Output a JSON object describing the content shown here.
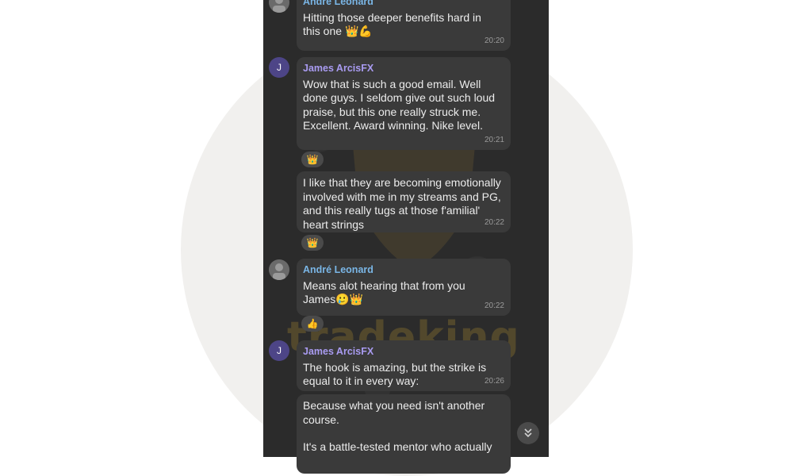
{
  "messages": [
    {
      "sender": "André Leonard",
      "text_line1": "Hitting those deeper benefits hard in",
      "text_line2": "this one",
      "emoji": "👑💪",
      "time": "20:20"
    },
    {
      "sender": "James ArcisFX",
      "avatar_letter": "J",
      "text": "Wow that is such a good email. Well done guys. I seldom give out such loud praise, but this one really struck me. Excellent. Award winning. Nike level.",
      "time": "20:21",
      "reaction": "👑"
    },
    {
      "text": "I like that they are becoming emotionally involved with me in my streams and PG, and this really tugs at those f'amilial' heart strings",
      "time": "20:22",
      "reaction": "👑"
    },
    {
      "sender": "André Leonard",
      "text_line1": "Means alot hearing that from you",
      "text_line2": "James",
      "emoji": "🥲👑",
      "time": "20:22",
      "reaction": "👍"
    },
    {
      "sender": "James ArcisFX",
      "avatar_letter": "J",
      "text": "The hook is amazing, but the strike is equal to it in every way:",
      "time": "20:26"
    },
    {
      "text_p1": "Because what you need isn't another course.",
      "text_p2": "It's a battle-tested mentor who actually"
    }
  ],
  "watermark": "tradeking",
  "colors": {
    "bubble": "#3a3a3a",
    "name_purple": "#a99bf1",
    "name_blue": "#7ab6e6"
  }
}
